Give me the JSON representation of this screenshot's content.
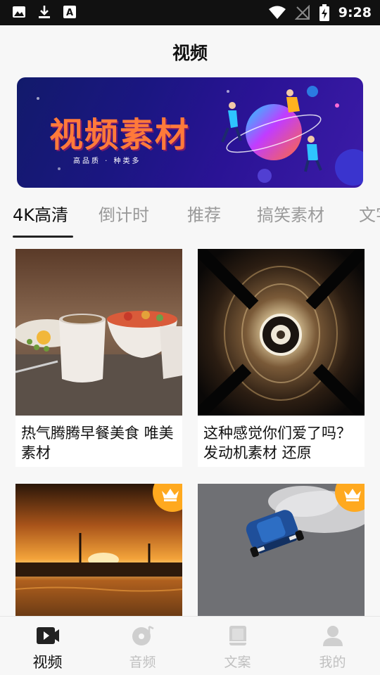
{
  "status_bar": {
    "time": "9:28",
    "left_icons": [
      "image-icon",
      "download-icon",
      "font-icon"
    ],
    "right_icons": [
      "wifi-icon",
      "no-signal-icon",
      "battery-charging-icon"
    ]
  },
  "header": {
    "title": "视频"
  },
  "banner": {
    "title": "视频素材",
    "subtitle": "高品质 · 种类多"
  },
  "tabs": [
    {
      "label": "4K高清",
      "active": true
    },
    {
      "label": "倒计时",
      "active": false
    },
    {
      "label": "推荐",
      "active": false
    },
    {
      "label": "搞笑素材",
      "active": false
    },
    {
      "label": "文字",
      "active": false
    }
  ],
  "videos": [
    {
      "caption": "热气腾腾早餐美食 唯美素材",
      "premium": false,
      "thumb": "breakfast"
    },
    {
      "caption": "这种感觉你们爱了吗？发动机素材 还原",
      "premium": false,
      "thumb": "engine"
    },
    {
      "caption": "",
      "premium": true,
      "thumb": "sunset"
    },
    {
      "caption": "",
      "premium": true,
      "thumb": "car"
    }
  ],
  "premium_icon": "crown-icon",
  "bottom_nav": [
    {
      "label": "视频",
      "icon": "video-icon",
      "active": true
    },
    {
      "label": "音频",
      "icon": "music-disc-icon",
      "active": false
    },
    {
      "label": "文案",
      "icon": "book-icon",
      "active": false
    },
    {
      "label": "我的",
      "icon": "person-icon",
      "active": false
    }
  ],
  "colors": {
    "accent": "#111111",
    "premium": "#ffa91f",
    "inactive": "#c0c0c0"
  }
}
